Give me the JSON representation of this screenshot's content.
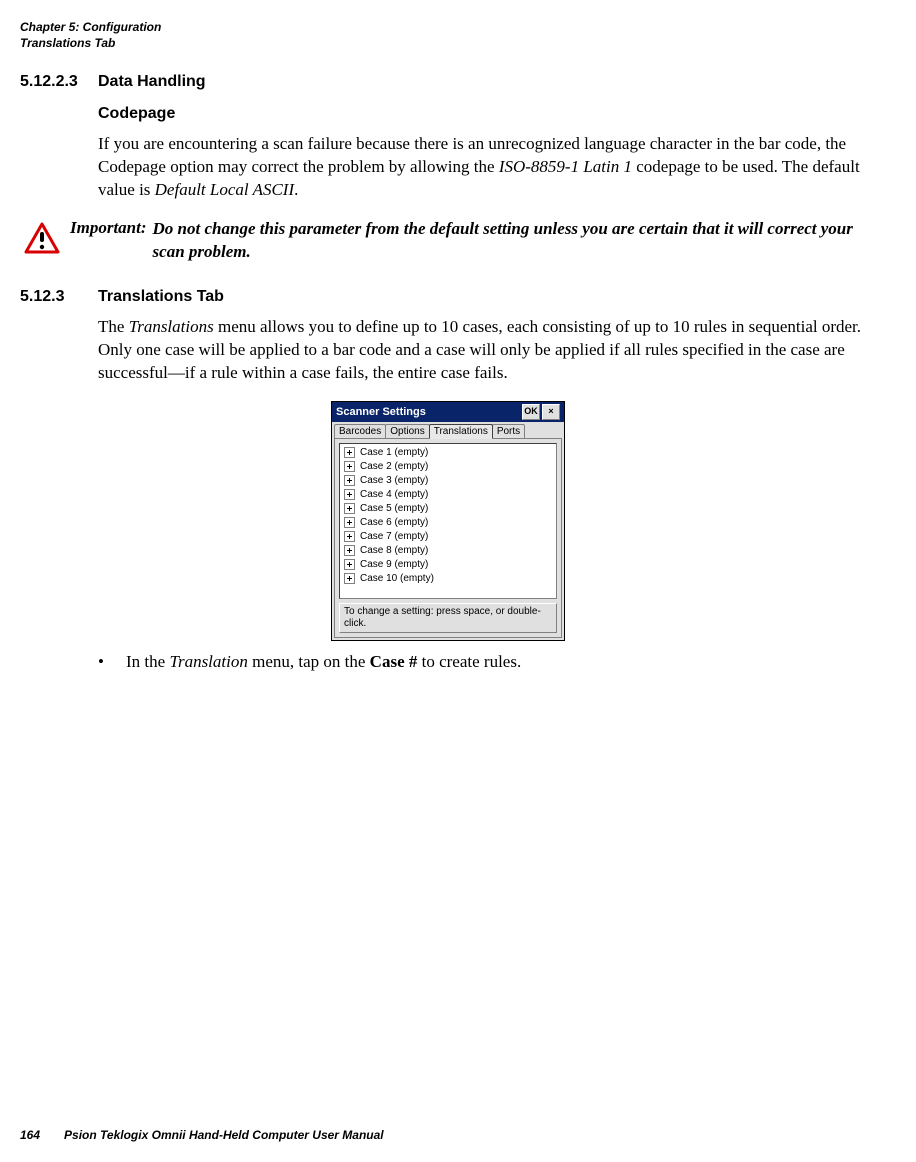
{
  "header": {
    "line1": "Chapter 5: Configuration",
    "line2": "Translations Tab"
  },
  "sec51223": {
    "num": "5.12.2.3",
    "title": "Data Handling"
  },
  "codepage": {
    "title": "Codepage",
    "p_a": "If you are encountering a scan failure because there is an unrecognized language character in the bar code, the Codepage option may correct the problem by allowing the ",
    "p_b": "ISO-8859-1 Latin 1",
    "p_c": " codepage to be used. The default value is ",
    "p_d": "Default Local ASCII",
    "p_e": "."
  },
  "important": {
    "label": "Important:",
    "text": "Do not change this parameter from the default setting unless you are certain that it will correct your scan problem."
  },
  "sec5123": {
    "num": "5.12.3",
    "title": "Translations Tab",
    "p_a": "The ",
    "p_b": "Translations",
    "p_c": " menu allows you to define up to 10 cases, each consisting of up to 10 rules in sequential order. Only one case will be applied to a bar code and a case will only be applied if all rules specified in the case are successful—if a rule within a case fails, the entire case fails."
  },
  "screenshot": {
    "title": "Scanner Settings",
    "ok": "OK",
    "close": "×",
    "tabs": [
      "Barcodes",
      "Options",
      "Translations",
      "Ports"
    ],
    "items": [
      "Case 1 (empty)",
      "Case 2 (empty)",
      "Case 3 (empty)",
      "Case 4 (empty)",
      "Case 5 (empty)",
      "Case 6 (empty)",
      "Case 7 (empty)",
      "Case 8 (empty)",
      "Case 9 (empty)",
      "Case 10 (empty)"
    ],
    "hint": "To change a setting: press space, or double-click."
  },
  "bullet": {
    "a": "In the ",
    "b": "Translation",
    "c": " menu, tap on the ",
    "d": "Case #",
    "e": " to create rules."
  },
  "footer": {
    "page": "164",
    "text": "Psion Teklogix Omnii Hand-Held Computer User Manual"
  }
}
